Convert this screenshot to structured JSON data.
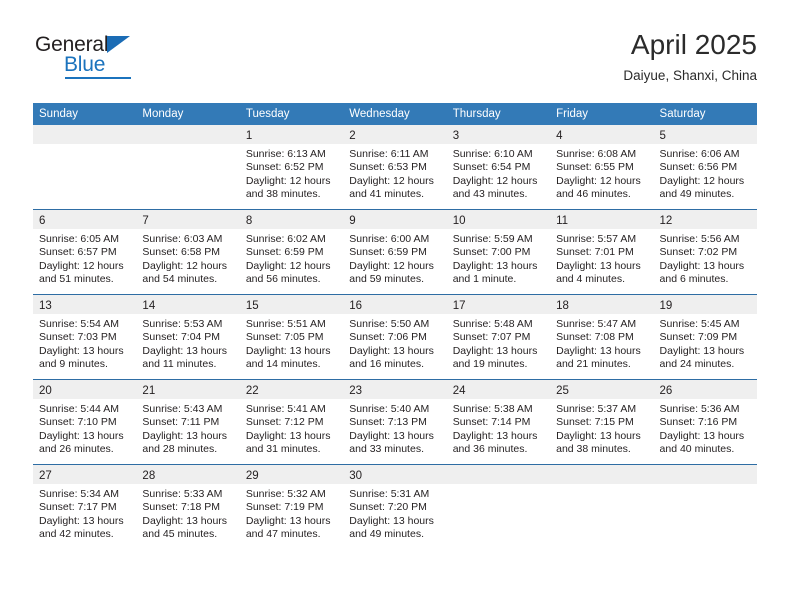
{
  "logo": {
    "top_text": "General",
    "bottom_text": "Blue",
    "accent_color": "#1b73bd"
  },
  "header": {
    "title": "April 2025",
    "subtitle": "Daiyue, Shanxi, China"
  },
  "theme": {
    "header_bg": "#337ab7",
    "row_divider": "#2e6da4",
    "day_band_bg": "#efefef",
    "text": "#231f20"
  },
  "weekday_headers": [
    "Sunday",
    "Monday",
    "Tuesday",
    "Wednesday",
    "Thursday",
    "Friday",
    "Saturday"
  ],
  "weeks": [
    [
      {
        "day": "",
        "lines": []
      },
      {
        "day": "",
        "lines": []
      },
      {
        "day": "1",
        "lines": [
          "Sunrise: 6:13 AM",
          "Sunset: 6:52 PM",
          "Daylight: 12 hours",
          "and 38 minutes."
        ]
      },
      {
        "day": "2",
        "lines": [
          "Sunrise: 6:11 AM",
          "Sunset: 6:53 PM",
          "Daylight: 12 hours",
          "and 41 minutes."
        ]
      },
      {
        "day": "3",
        "lines": [
          "Sunrise: 6:10 AM",
          "Sunset: 6:54 PM",
          "Daylight: 12 hours",
          "and 43 minutes."
        ]
      },
      {
        "day": "4",
        "lines": [
          "Sunrise: 6:08 AM",
          "Sunset: 6:55 PM",
          "Daylight: 12 hours",
          "and 46 minutes."
        ]
      },
      {
        "day": "5",
        "lines": [
          "Sunrise: 6:06 AM",
          "Sunset: 6:56 PM",
          "Daylight: 12 hours",
          "and 49 minutes."
        ]
      }
    ],
    [
      {
        "day": "6",
        "lines": [
          "Sunrise: 6:05 AM",
          "Sunset: 6:57 PM",
          "Daylight: 12 hours",
          "and 51 minutes."
        ]
      },
      {
        "day": "7",
        "lines": [
          "Sunrise: 6:03 AM",
          "Sunset: 6:58 PM",
          "Daylight: 12 hours",
          "and 54 minutes."
        ]
      },
      {
        "day": "8",
        "lines": [
          "Sunrise: 6:02 AM",
          "Sunset: 6:59 PM",
          "Daylight: 12 hours",
          "and 56 minutes."
        ]
      },
      {
        "day": "9",
        "lines": [
          "Sunrise: 6:00 AM",
          "Sunset: 6:59 PM",
          "Daylight: 12 hours",
          "and 59 minutes."
        ]
      },
      {
        "day": "10",
        "lines": [
          "Sunrise: 5:59 AM",
          "Sunset: 7:00 PM",
          "Daylight: 13 hours",
          "and 1 minute."
        ]
      },
      {
        "day": "11",
        "lines": [
          "Sunrise: 5:57 AM",
          "Sunset: 7:01 PM",
          "Daylight: 13 hours",
          "and 4 minutes."
        ]
      },
      {
        "day": "12",
        "lines": [
          "Sunrise: 5:56 AM",
          "Sunset: 7:02 PM",
          "Daylight: 13 hours",
          "and 6 minutes."
        ]
      }
    ],
    [
      {
        "day": "13",
        "lines": [
          "Sunrise: 5:54 AM",
          "Sunset: 7:03 PM",
          "Daylight: 13 hours",
          "and 9 minutes."
        ]
      },
      {
        "day": "14",
        "lines": [
          "Sunrise: 5:53 AM",
          "Sunset: 7:04 PM",
          "Daylight: 13 hours",
          "and 11 minutes."
        ]
      },
      {
        "day": "15",
        "lines": [
          "Sunrise: 5:51 AM",
          "Sunset: 7:05 PM",
          "Daylight: 13 hours",
          "and 14 minutes."
        ]
      },
      {
        "day": "16",
        "lines": [
          "Sunrise: 5:50 AM",
          "Sunset: 7:06 PM",
          "Daylight: 13 hours",
          "and 16 minutes."
        ]
      },
      {
        "day": "17",
        "lines": [
          "Sunrise: 5:48 AM",
          "Sunset: 7:07 PM",
          "Daylight: 13 hours",
          "and 19 minutes."
        ]
      },
      {
        "day": "18",
        "lines": [
          "Sunrise: 5:47 AM",
          "Sunset: 7:08 PM",
          "Daylight: 13 hours",
          "and 21 minutes."
        ]
      },
      {
        "day": "19",
        "lines": [
          "Sunrise: 5:45 AM",
          "Sunset: 7:09 PM",
          "Daylight: 13 hours",
          "and 24 minutes."
        ]
      }
    ],
    [
      {
        "day": "20",
        "lines": [
          "Sunrise: 5:44 AM",
          "Sunset: 7:10 PM",
          "Daylight: 13 hours",
          "and 26 minutes."
        ]
      },
      {
        "day": "21",
        "lines": [
          "Sunrise: 5:43 AM",
          "Sunset: 7:11 PM",
          "Daylight: 13 hours",
          "and 28 minutes."
        ]
      },
      {
        "day": "22",
        "lines": [
          "Sunrise: 5:41 AM",
          "Sunset: 7:12 PM",
          "Daylight: 13 hours",
          "and 31 minutes."
        ]
      },
      {
        "day": "23",
        "lines": [
          "Sunrise: 5:40 AM",
          "Sunset: 7:13 PM",
          "Daylight: 13 hours",
          "and 33 minutes."
        ]
      },
      {
        "day": "24",
        "lines": [
          "Sunrise: 5:38 AM",
          "Sunset: 7:14 PM",
          "Daylight: 13 hours",
          "and 36 minutes."
        ]
      },
      {
        "day": "25",
        "lines": [
          "Sunrise: 5:37 AM",
          "Sunset: 7:15 PM",
          "Daylight: 13 hours",
          "and 38 minutes."
        ]
      },
      {
        "day": "26",
        "lines": [
          "Sunrise: 5:36 AM",
          "Sunset: 7:16 PM",
          "Daylight: 13 hours",
          "and 40 minutes."
        ]
      }
    ],
    [
      {
        "day": "27",
        "lines": [
          "Sunrise: 5:34 AM",
          "Sunset: 7:17 PM",
          "Daylight: 13 hours",
          "and 42 minutes."
        ]
      },
      {
        "day": "28",
        "lines": [
          "Sunrise: 5:33 AM",
          "Sunset: 7:18 PM",
          "Daylight: 13 hours",
          "and 45 minutes."
        ]
      },
      {
        "day": "29",
        "lines": [
          "Sunrise: 5:32 AM",
          "Sunset: 7:19 PM",
          "Daylight: 13 hours",
          "and 47 minutes."
        ]
      },
      {
        "day": "30",
        "lines": [
          "Sunrise: 5:31 AM",
          "Sunset: 7:20 PM",
          "Daylight: 13 hours",
          "and 49 minutes."
        ]
      },
      {
        "day": "",
        "lines": []
      },
      {
        "day": "",
        "lines": []
      },
      {
        "day": "",
        "lines": []
      }
    ]
  ]
}
